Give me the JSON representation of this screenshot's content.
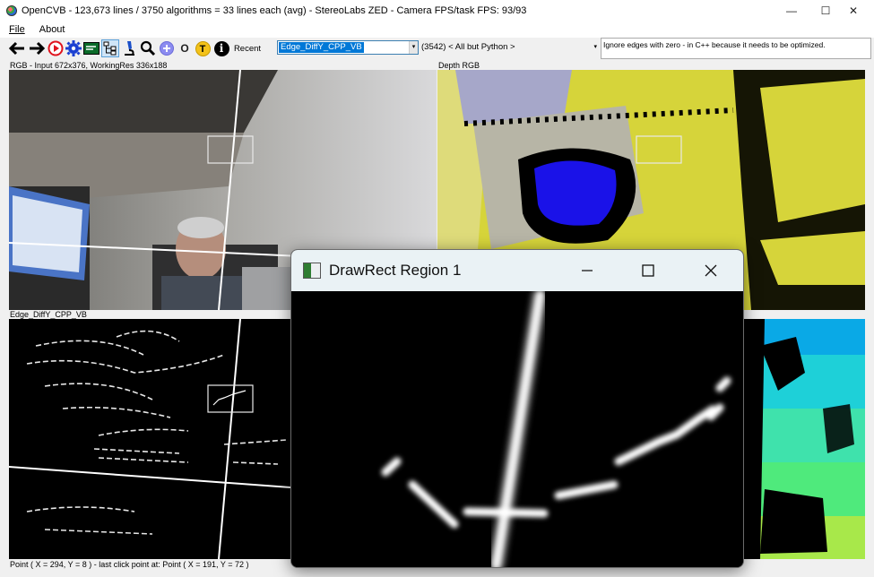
{
  "window": {
    "title": "OpenCVB - 123,673 lines / 3750 algorithms = 33 lines each (avg) - StereoLabs ZED - Camera FPS/task FPS: 93/93",
    "minimize": "—",
    "maximize": "☐",
    "close": "✕"
  },
  "menu": {
    "file": "File",
    "about": "About"
  },
  "toolbar": {
    "back_icon": "arrow-left-icon",
    "forward_icon": "arrow-right-icon",
    "recent_label": "Recent",
    "algorithm": "Edge_DiffY_CPP_VB",
    "group": "(3542) < All but Python >",
    "dropdown_arrow": "▾",
    "description": "Ignore edges with zero - in C++ because it needs to be optimized.",
    "badge_t": "T",
    "badge_i": "i",
    "badge_o": "O"
  },
  "panels": {
    "rgb_label": "RGB - Input 672x376, WorkingRes 336x188",
    "depth_label": "Depth RGB",
    "edge_label": "Edge_DiffY_CPP_VB"
  },
  "status": "Point ( X = 294, Y = 8 ) - last click point at: Point ( X = 191, Y = 72 )",
  "popup": {
    "title": "DrawRect Region 1",
    "minimize": "—",
    "maximize": "☐",
    "close": "✕"
  },
  "colors": {
    "depth_yellow": "#d6d43a",
    "depth_blue": "#1a12e8",
    "selection_blue": "#0078d7"
  }
}
